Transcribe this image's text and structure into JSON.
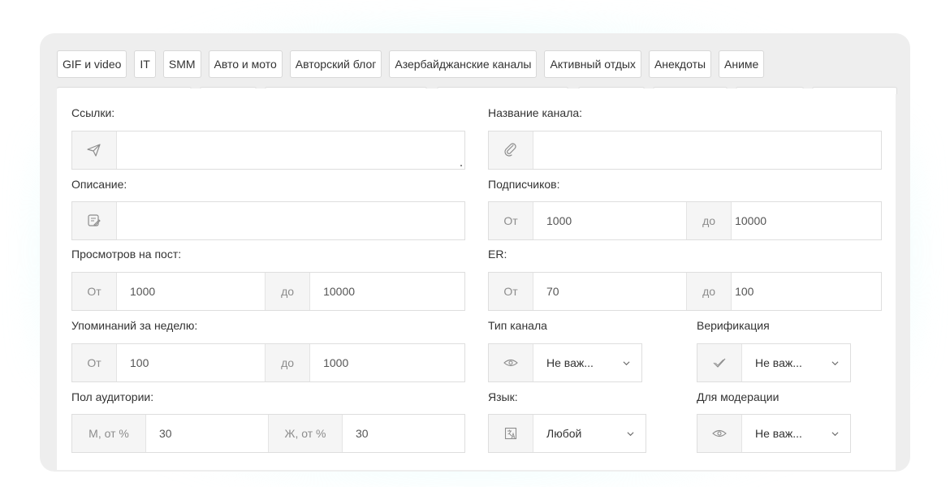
{
  "categories": [
    "GIF и video",
    "IT",
    "SMM",
    "Авто и мото",
    "Авторский блог",
    "Азербайджанские каналы",
    "Активный отдых",
    "Анекдоты",
    "Аниме"
  ],
  "links": {
    "label": "Ссылки:",
    "icon": "send-icon",
    "value": ""
  },
  "channel_name": {
    "label": "Название канала:",
    "icon": "paperclip-icon",
    "value": ""
  },
  "description": {
    "label": "Описание:",
    "icon": "note-icon",
    "value": ""
  },
  "subscribers": {
    "label": "Подписчиков:",
    "from_label": "От",
    "from": "1000",
    "to_label": "до",
    "to": "10000"
  },
  "views_per_post": {
    "label": "Просмотров на пост:",
    "from_label": "От",
    "from": "1000",
    "to_label": "до",
    "to": "10000"
  },
  "er": {
    "label": "ER:",
    "from_label": "От",
    "from": "70",
    "to_label": "до",
    "to": "100"
  },
  "mentions_week": {
    "label": "Упоминаний за неделю:",
    "from_label": "От",
    "from": "100",
    "to_label": "до",
    "to": "1000"
  },
  "channel_type": {
    "label": "Тип канала",
    "icon": "eye-icon",
    "value": "Не важ..."
  },
  "verification": {
    "label": "Верификация",
    "icon": "check-icon",
    "value": "Не важ..."
  },
  "audience_gender": {
    "label": "Пол аудитории:",
    "male_label": "М, от %",
    "male": "30",
    "female_label": "Ж, от %",
    "female": "30"
  },
  "language": {
    "label": "Язык:",
    "icon": "translate-icon",
    "value": "Любой"
  },
  "moderation": {
    "label": "Для модерации",
    "icon": "eye-icon",
    "value": "Не важ..."
  },
  "colors": {
    "card": "#eeeeee",
    "addon": "#f5f5f5",
    "border": "#dedede",
    "glow": "#c8fafa"
  }
}
